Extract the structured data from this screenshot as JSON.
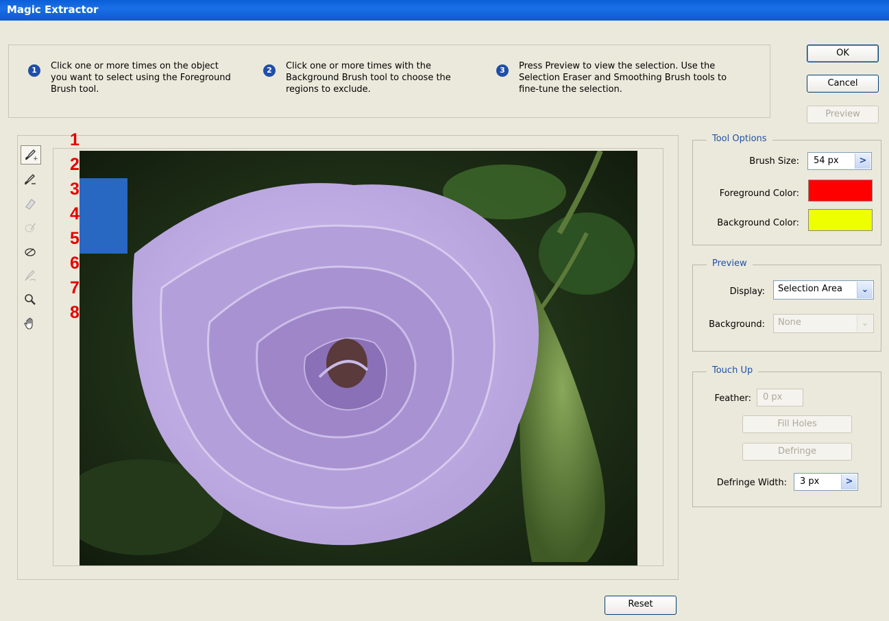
{
  "window": {
    "title": "Magic Extractor"
  },
  "steps": [
    {
      "num": "1",
      "text": "Click one or more times on the object you want to select using the Foreground Brush tool."
    },
    {
      "num": "2",
      "text": "Click one or more times with the Background Brush tool to choose the regions to exclude."
    },
    {
      "num": "3",
      "text": "Press Preview to view the selection. Use the Selection Eraser and Smoothing Brush tools to fine-tune the selection."
    }
  ],
  "buttons": {
    "ok": "OK",
    "cancel": "Cancel",
    "preview": "Preview",
    "reset": "Reset"
  },
  "tools": [
    "foreground-brush-icon",
    "background-brush-icon",
    "point-eraser-icon",
    "add-to-selection-icon",
    "remove-from-selection-icon",
    "smoothing-brush-icon",
    "zoom-icon",
    "hand-icon"
  ],
  "tool_numbers": [
    "1",
    "2",
    "3",
    "4",
    "5",
    "6",
    "7",
    "8"
  ],
  "tool_options": {
    "legend": "Tool Options",
    "brush_size_label": "Brush Size:",
    "brush_size_value": "54 px",
    "foreground_label": "Foreground Color:",
    "foreground_color": "#ff0000",
    "background_label": "Background Color:",
    "background_color": "#eeff00"
  },
  "preview": {
    "legend": "Preview",
    "display_label": "Display:",
    "display_value": "Selection Area",
    "background_label": "Background:",
    "background_value": "None"
  },
  "touch_up": {
    "legend": "Touch Up",
    "feather_label": "Feather:",
    "feather_value": "0 px",
    "fill_holes": "Fill Holes",
    "defringe": "Defringe",
    "defringe_width_label": "Defringe Width:",
    "defringe_width_value": "3 px"
  },
  "arrow_glyph": ">",
  "dropdown_glyph": "⌄"
}
